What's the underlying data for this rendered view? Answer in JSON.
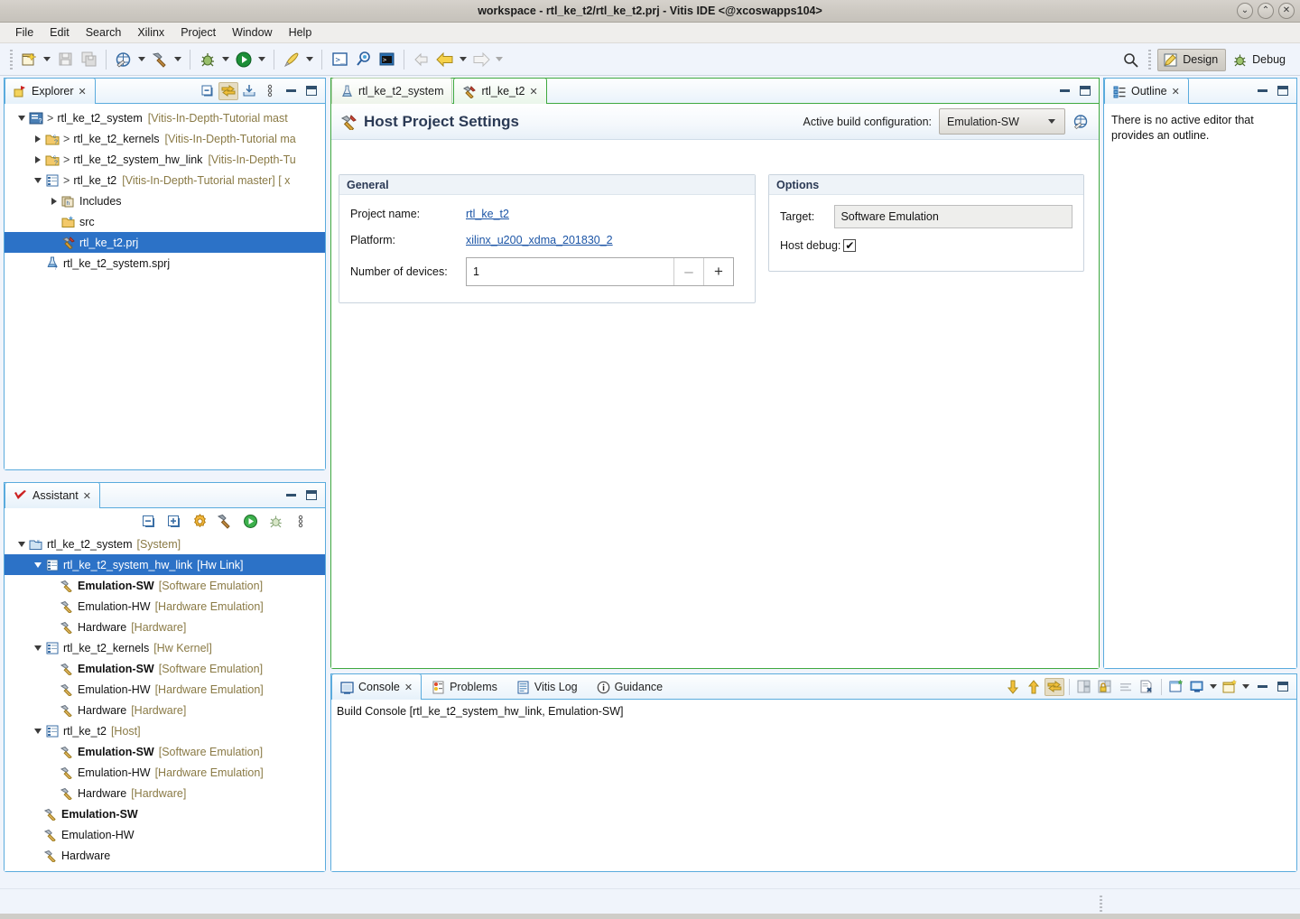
{
  "window": {
    "title": "workspace - rtl_ke_t2/rtl_ke_t2.prj - Vitis IDE  <@xcoswapps104>",
    "minimize": "⌄",
    "maximize": "⌃",
    "close": "✕"
  },
  "menubar": {
    "items": [
      "File",
      "Edit",
      "Search",
      "Xilinx",
      "Project",
      "Window",
      "Help"
    ]
  },
  "toolbar": {
    "perspectives": [
      {
        "label": "Design",
        "active": true
      },
      {
        "label": "Debug",
        "active": false
      }
    ]
  },
  "explorer": {
    "tab_label": "Explorer",
    "tab_close": "✕",
    "tree": [
      {
        "indent": 0,
        "twist": "down",
        "icon": "project-system-icon",
        "arrow": ">",
        "label": "rtl_ke_t2_system",
        "meta": "[Vitis-In-Depth-Tutorial mast",
        "selected": false
      },
      {
        "indent": 1,
        "twist": "right",
        "icon": "project-c-icon",
        "arrow": ">",
        "label": "rtl_ke_t2_kernels",
        "meta": "[Vitis-In-Depth-Tutorial ma",
        "selected": false
      },
      {
        "indent": 1,
        "twist": "right",
        "icon": "project-c-icon",
        "arrow": ">",
        "label": "rtl_ke_t2_system_hw_link",
        "meta": "[Vitis-In-Depth-Tu",
        "selected": false
      },
      {
        "indent": 1,
        "twist": "down",
        "icon": "project-link-icon",
        "arrow": ">",
        "label": "rtl_ke_t2",
        "meta": "[Vitis-In-Depth-Tutorial master] [ x",
        "selected": false
      },
      {
        "indent": 2,
        "twist": "right",
        "icon": "includes-icon",
        "arrow": "",
        "label": "Includes",
        "meta": "",
        "selected": false
      },
      {
        "indent": 2,
        "twist": "none",
        "icon": "source-folder-icon",
        "arrow": "",
        "label": "src",
        "meta": "",
        "selected": false
      },
      {
        "indent": 2,
        "twist": "none",
        "icon": "prj-file-icon",
        "arrow": "",
        "label": "rtl_ke_t2.prj",
        "meta": "",
        "selected": true
      },
      {
        "indent": 1,
        "twist": "none",
        "icon": "sprj-file-icon",
        "arrow": "",
        "label": "rtl_ke_t2_system.sprj",
        "meta": "",
        "selected": false
      }
    ]
  },
  "assistant": {
    "tab_label": "Assistant",
    "tab_close": "✕",
    "tree": [
      {
        "indent": 0,
        "twist": "down",
        "icon": "system-folder-icon",
        "label": "rtl_ke_t2_system",
        "meta": "[System]",
        "bold": false,
        "selected": false
      },
      {
        "indent": 1,
        "twist": "down",
        "icon": "hw-link-icon",
        "label": "rtl_ke_t2_system_hw_link",
        "meta": "[Hw Link]",
        "bold": false,
        "selected": true
      },
      {
        "indent": 2,
        "twist": "none",
        "icon": "build-hammer-icon",
        "label": "Emulation-SW",
        "meta": "[Software Emulation]",
        "bold": true,
        "selected": false
      },
      {
        "indent": 2,
        "twist": "none",
        "icon": "build-hammer-icon",
        "label": "Emulation-HW",
        "meta": "[Hardware Emulation]",
        "bold": false,
        "selected": false
      },
      {
        "indent": 2,
        "twist": "none",
        "icon": "build-hammer-icon",
        "label": "Hardware",
        "meta": "[Hardware]",
        "bold": false,
        "selected": false
      },
      {
        "indent": 1,
        "twist": "down",
        "icon": "hw-kernel-icon",
        "label": "rtl_ke_t2_kernels",
        "meta": "[Hw Kernel]",
        "bold": false,
        "selected": false
      },
      {
        "indent": 2,
        "twist": "none",
        "icon": "build-hammer-icon",
        "label": "Emulation-SW",
        "meta": "[Software Emulation]",
        "bold": true,
        "selected": false
      },
      {
        "indent": 2,
        "twist": "none",
        "icon": "build-hammer-icon",
        "label": "Emulation-HW",
        "meta": "[Hardware Emulation]",
        "bold": false,
        "selected": false
      },
      {
        "indent": 2,
        "twist": "none",
        "icon": "build-hammer-icon",
        "label": "Hardware",
        "meta": "[Hardware]",
        "bold": false,
        "selected": false
      },
      {
        "indent": 1,
        "twist": "down",
        "icon": "host-icon",
        "label": "rtl_ke_t2",
        "meta": "[Host]",
        "bold": false,
        "selected": false
      },
      {
        "indent": 2,
        "twist": "none",
        "icon": "build-hammer-icon",
        "label": "Emulation-SW",
        "meta": "[Software Emulation]",
        "bold": true,
        "selected": false
      },
      {
        "indent": 2,
        "twist": "none",
        "icon": "build-hammer-icon",
        "label": "Emulation-HW",
        "meta": "[Hardware Emulation]",
        "bold": false,
        "selected": false
      },
      {
        "indent": 2,
        "twist": "none",
        "icon": "build-hammer-icon",
        "label": "Hardware",
        "meta": "[Hardware]",
        "bold": false,
        "selected": false
      },
      {
        "indent": 1,
        "twist": "none",
        "icon": "build-hammer-icon",
        "label": "Emulation-SW",
        "meta": "",
        "bold": true,
        "selected": false
      },
      {
        "indent": 1,
        "twist": "none",
        "icon": "build-hammer-icon",
        "label": "Emulation-HW",
        "meta": "",
        "bold": false,
        "selected": false
      },
      {
        "indent": 1,
        "twist": "none",
        "icon": "build-hammer-icon",
        "label": "Hardware",
        "meta": "",
        "bold": false,
        "selected": false
      }
    ]
  },
  "editor": {
    "tabs": [
      {
        "label": "rtl_ke_t2_system",
        "icon": "flask-icon",
        "active": false,
        "close": ""
      },
      {
        "label": "rtl_ke_t2",
        "icon": "tools-icon",
        "active": true,
        "close": "✕"
      }
    ],
    "title": "Host Project Settings",
    "active_build_label": "Active build configuration:",
    "active_build_value": "Emulation-SW",
    "general": {
      "title": "General",
      "project_name_label": "Project name:",
      "project_name_value": "rtl_ke_t2",
      "platform_label": "Platform:",
      "platform_value": "xilinx_u200_xdma_201830_2",
      "devices_label": "Number of devices:",
      "devices_value": "1",
      "minus": "–",
      "plus": "+"
    },
    "options": {
      "title": "Options",
      "target_label": "Target:",
      "target_value": "Software Emulation",
      "host_debug_label": "Host debug:",
      "host_debug_checked": "✔"
    }
  },
  "outline": {
    "tab_label": "Outline",
    "tab_close": "✕",
    "message": "There is no active editor that provides an outline."
  },
  "console": {
    "tabs": [
      {
        "label": "Console",
        "icon": "console-icon",
        "active": true,
        "close": "✕"
      },
      {
        "label": "Problems",
        "icon": "problems-icon",
        "active": false,
        "close": ""
      },
      {
        "label": "Vitis Log",
        "icon": "log-icon",
        "active": false,
        "close": ""
      },
      {
        "label": "Guidance",
        "icon": "info-icon",
        "active": false,
        "close": ""
      }
    ],
    "build_line": "Build Console [rtl_ke_t2_system_hw_link, Emulation-SW]",
    "content": ""
  },
  "colors": {
    "selection_blue": "#2c72c7",
    "view_border": "#5aabdd",
    "active_editor_border": "#3fa93f",
    "link": "#1c55a6",
    "meta_text": "#8a7a45",
    "title_text": "#2b3a55"
  }
}
